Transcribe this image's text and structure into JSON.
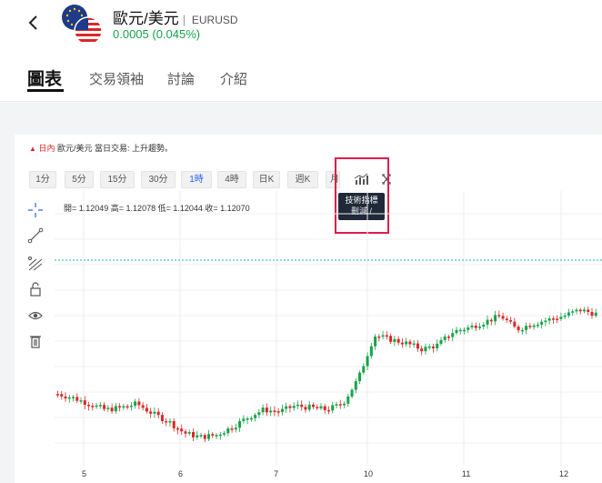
{
  "header": {
    "pair_name": "歐元/美元",
    "pair_code": "EURUSD",
    "change": "0.0005 (0.045%)"
  },
  "tabs": [
    {
      "label": "圖表",
      "active": true
    },
    {
      "label": "交易領袖",
      "active": false
    },
    {
      "label": "討論",
      "active": false
    },
    {
      "label": "介紹",
      "active": false
    }
  ],
  "chart_info": {
    "arrow": "▲",
    "timeframe_note": "日內",
    "text": "歐元/美元 當日交易: 上升趨勢。"
  },
  "timeframes": [
    "1分",
    "5分",
    "15分",
    "30分",
    "1時",
    "4時",
    "日K",
    "週K",
    "月"
  ],
  "active_timeframe": "1時",
  "toolbar_icons": [
    "indicator-icon",
    "fullscreen-icon"
  ],
  "tooltip": {
    "line1": "技術指標",
    "line2": "刪減 /"
  },
  "ohlc": "開= 1.12049  高= 1.12078  低= 1.12044  收= 1.12070",
  "side_tools": [
    "crosshair-icon",
    "trendline-icon",
    "fibonacci-icon",
    "lock-icon",
    "eye-icon",
    "trash-icon"
  ],
  "colors": {
    "up": "#16a34a",
    "down": "#dc2626",
    "accent": "#2563eb",
    "highlight": "#e11d48"
  },
  "chart_data": {
    "type": "candlestick",
    "x_tick_labels": [
      "5",
      "6",
      "7",
      "10",
      "11",
      "12"
    ],
    "price_path_relative": [
      0.32,
      0.3,
      0.27,
      0.24,
      0.25,
      0.27,
      0.22,
      0.18,
      0.12,
      0.1,
      0.11,
      0.15,
      0.2,
      0.24,
      0.23,
      0.26,
      0.25,
      0.24,
      0.27,
      0.4,
      0.62,
      0.6,
      0.58,
      0.55,
      0.57,
      0.64,
      0.66,
      0.69,
      0.72,
      0.65,
      0.68,
      0.7,
      0.72,
      0.75,
      0.73
    ]
  }
}
